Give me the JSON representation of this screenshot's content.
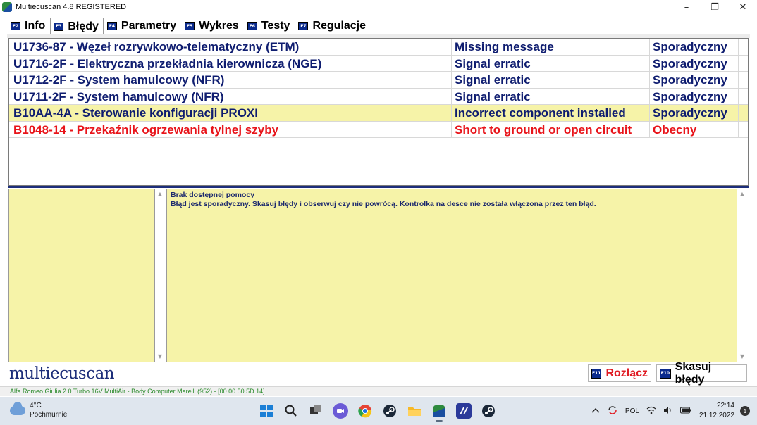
{
  "window": {
    "title": "Multiecuscan 4.8 REGISTERED",
    "minimize": "–",
    "restore": "❐",
    "close": "✕"
  },
  "tabs": [
    {
      "fkey": "F2",
      "label": "Info",
      "active": false
    },
    {
      "fkey": "F3",
      "label": "Błędy",
      "active": true
    },
    {
      "fkey": "F4",
      "label": "Parametry",
      "active": false
    },
    {
      "fkey": "F5",
      "label": "Wykres",
      "active": false
    },
    {
      "fkey": "F6",
      "label": "Testy",
      "active": false
    },
    {
      "fkey": "F7",
      "label": "Regulacje",
      "active": false
    }
  ],
  "dtc_rows": [
    {
      "code": "U1736-87 - Węzeł rozrywkowo-telematyczny (ETM)",
      "description": "Missing message",
      "status": "Sporadyczny",
      "color": "#0f1d70",
      "highlight": false
    },
    {
      "code": "U1716-2F - Elektryczna przekładnia kierownicza (NGE)",
      "description": "Signal erratic",
      "status": "Sporadyczny",
      "color": "#0f1d70",
      "highlight": false
    },
    {
      "code": "U1712-2F - System hamulcowy (NFR)",
      "description": "Signal erratic",
      "status": "Sporadyczny",
      "color": "#0f1d70",
      "highlight": false
    },
    {
      "code": "U1711-2F - System hamulcowy (NFR)",
      "description": "Signal erratic",
      "status": "Sporadyczny",
      "color": "#0f1d70",
      "highlight": false
    },
    {
      "code": "B10AA-4A - Sterowanie konfiguracji PROXI",
      "description": "Incorrect component installed",
      "status": "Sporadyczny",
      "color": "#0f1d70",
      "highlight": true
    },
    {
      "code": "B1048-14 - Przekaźnik ogrzewania tylnej szyby",
      "description": "Short to ground or open circuit",
      "status": "Obecny",
      "color": "#e8141a",
      "highlight": false
    }
  ],
  "help": {
    "line1": "Brak dostępnej pomocy",
    "line2": "Błąd jest sporadyczny. Skasuj błędy i obserwuj czy nie powrócą. Kontrolka na desce nie została włączona przez ten błąd."
  },
  "footer": {
    "logo": "multiecuscan",
    "disconnect_fkey": "F11",
    "disconnect_label": "Rozłącz",
    "clear_fkey": "F10",
    "clear_label": "Skasuj błędy",
    "status_text": "Alfa Romeo Giulia 2.0 Turbo 16V MultiAir - Body Computer Marelli (952) - [00 00 50 5D 14]"
  },
  "taskbar": {
    "temperature": "4°C",
    "weather": "Pochmurnie",
    "language": "POL",
    "time": "22:14",
    "date": "21.12.2022",
    "notifications": "1",
    "icons": [
      "windows-start-icon",
      "search-icon",
      "task-view-icon",
      "chat-icon",
      "chrome-icon",
      "steam-icon",
      "file-explorer-icon",
      "multiecuscan-icon",
      "app-icon",
      "steam-icon"
    ]
  },
  "colors": {
    "navy": "#0f1d70",
    "red": "#e8141a",
    "highlight": "#f6f3a8",
    "fkey": "#0a2a8c"
  }
}
